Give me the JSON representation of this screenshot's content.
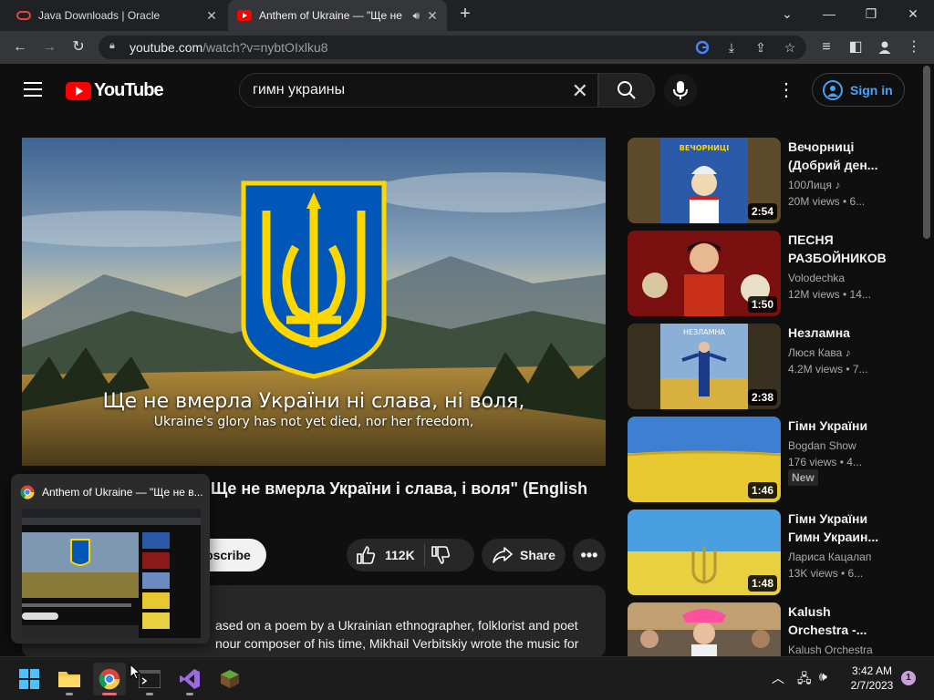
{
  "browser": {
    "tabs": [
      {
        "title": "Java Downloads | Oracle",
        "active": false
      },
      {
        "title": "Anthem of Ukraine — \"Ще не",
        "active": true
      }
    ],
    "url_host": "youtube.com",
    "url_path": "/watch?v=nybtOIxlku8"
  },
  "youtube": {
    "logo_text": "YouTube",
    "search_query": "гимн украины",
    "signin_label": "Sign in"
  },
  "video": {
    "lyric_line": "Ще не вмерла України ні слава, ні воля,",
    "lyric_translation": "Ukraine's glory has not yet died, nor her freedom,",
    "title_visible": "Ще не вмерла України і слава, і воля\" (English",
    "subscribe_label": "Subscribe",
    "likes": "112K",
    "share_label": "Share",
    "description_lines": [
      "ased on a poem by a Ukrainian ethnographer, folklorist and poet",
      "nour composer of his time, Mikhail Verbitskiy wrote the music for",
      "  the  e  s  f  ll  f th  fi  t  ti  ll  f th  l  i  l"
    ]
  },
  "recommendations": [
    {
      "title": "Вечорниці (Добрий ден...",
      "channel": "100Лиця",
      "music_note": true,
      "meta": "20M views • 6...",
      "duration": "2:54",
      "badge": ""
    },
    {
      "title": "ПЕСНЯ РАЗБОЙНИКОВ",
      "channel": "Volodechka",
      "music_note": false,
      "meta": "12M views • 14...",
      "duration": "1:50",
      "badge": ""
    },
    {
      "title": "Незламна",
      "channel": "Люся Кава",
      "music_note": true,
      "meta": "4.2M views • 7...",
      "duration": "2:38",
      "badge": ""
    },
    {
      "title": "Гімн України",
      "channel": "Bogdan Show",
      "music_note": false,
      "meta": "176 views • 4...",
      "duration": "1:46",
      "badge": "New"
    },
    {
      "title": "Гімн України Гимн Украин...",
      "channel": "Лариса Кацалап",
      "music_note": false,
      "meta": "13K views • 6...",
      "duration": "1:48",
      "badge": ""
    },
    {
      "title": "Kalush Orchestra -...",
      "channel": "Kalush Orchestra",
      "music_note": false,
      "meta": "",
      "duration": "",
      "badge": ""
    }
  ],
  "thumbnail_texts": {
    "rec1_top": "ВЕЧОРНИЦІ",
    "rec3_top": "НЕЗЛАМНА"
  },
  "taskbar_preview": {
    "title": "Anthem of Ukraine — \"Ще не в..."
  },
  "taskbar": {
    "time": "3:42 AM",
    "date": "2/7/2023",
    "notification_count": "1"
  },
  "colors": {
    "youtube_red": "#ff0000",
    "link_blue": "#3ea6ff",
    "flag_blue": "#0057b7",
    "flag_yellow": "#ffd700"
  }
}
